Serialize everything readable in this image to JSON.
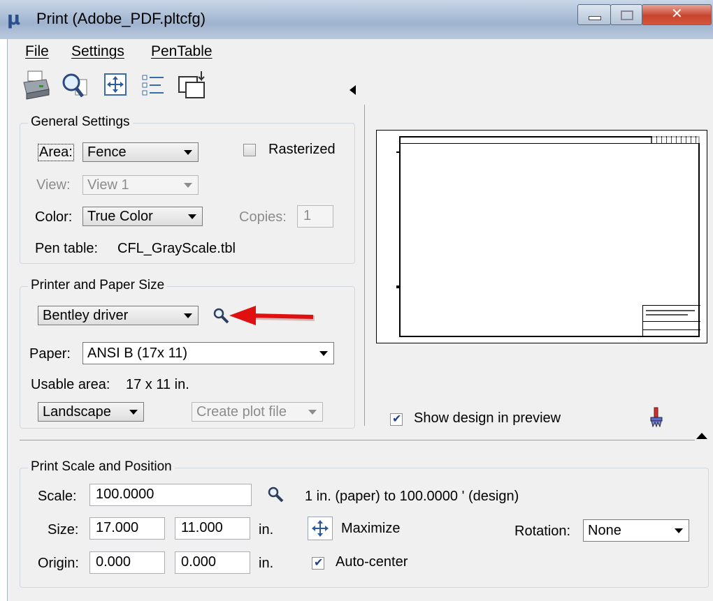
{
  "window": {
    "title": "Print  (Adobe_PDF.pltcfg)",
    "logo_glyph": "μ"
  },
  "menu": {
    "file": "File",
    "settings": "Settings",
    "pentable": "PenTable"
  },
  "toolbar": {
    "icons": [
      "printer-icon",
      "preview-magnifier-icon",
      "maximize-icon",
      "list-icon",
      "copy-window-icon"
    ]
  },
  "general": {
    "legend": "General Settings",
    "area_label": "Area:",
    "area_value": "Fence",
    "rasterized_label": "Rasterized",
    "view_label": "View:",
    "view_value": "View 1",
    "color_label": "Color:",
    "color_value": "True Color",
    "copies_label": "Copies:",
    "copies_value": "1",
    "pentable_label": "Pen table:",
    "pentable_value": "CFL_GrayScale.tbl"
  },
  "printer": {
    "legend": "Printer and Paper Size",
    "driver_value": "Bentley driver",
    "paper_label": "Paper:",
    "paper_value": "ANSI B (17x 11)",
    "usable_label": "Usable area:",
    "usable_value": "17 x 11 in.",
    "orientation_value": "Landscape",
    "plotfile_value": "Create plot file"
  },
  "preview": {
    "show_design_label": "Show design in preview",
    "show_design_checked": true
  },
  "scale": {
    "legend": "Print Scale and Position",
    "scale_label": "Scale:",
    "scale_value": "100.0000",
    "scale_desc": "1 in. (paper) to 100.0000 ' (design)",
    "size_label": "Size:",
    "size_w": "17.000",
    "size_h": "11.000",
    "size_unit": "in.",
    "maximize_label": "Maximize",
    "rotation_label": "Rotation:",
    "rotation_value": "None",
    "origin_label": "Origin:",
    "origin_x": "0.000",
    "origin_y": "0.000",
    "origin_unit": "in.",
    "autocenter_label": "Auto-center",
    "autocenter_checked": true
  },
  "colors": {
    "annotation_arrow": "#e01010"
  }
}
